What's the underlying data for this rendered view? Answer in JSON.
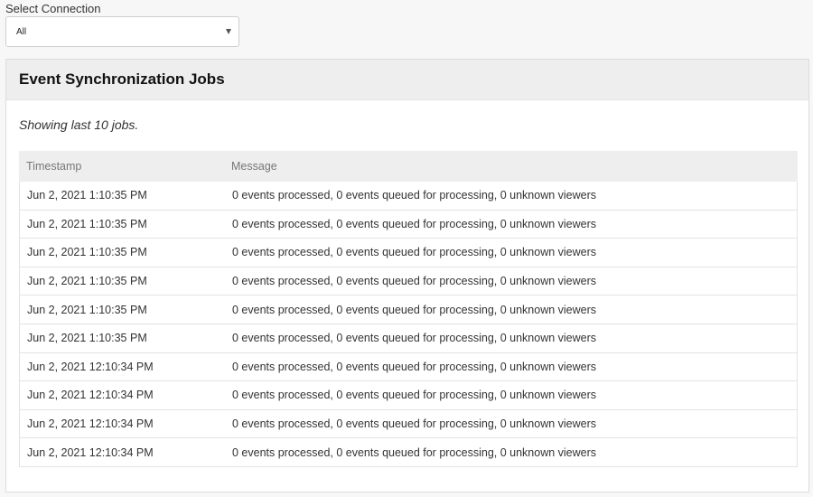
{
  "connection": {
    "label": "Select Connection",
    "selected": "All"
  },
  "panel": {
    "title": "Event Synchronization Jobs",
    "subtitle": "Showing last 10 jobs."
  },
  "table": {
    "headers": {
      "timestamp": "Timestamp",
      "message": "Message"
    },
    "rows": [
      {
        "timestamp": "Jun 2, 2021 1:10:35 PM",
        "message": "0 events processed, 0 events queued for processing, 0 unknown viewers"
      },
      {
        "timestamp": "Jun 2, 2021 1:10:35 PM",
        "message": "0 events processed, 0 events queued for processing, 0 unknown viewers"
      },
      {
        "timestamp": "Jun 2, 2021 1:10:35 PM",
        "message": "0 events processed, 0 events queued for processing, 0 unknown viewers"
      },
      {
        "timestamp": "Jun 2, 2021 1:10:35 PM",
        "message": "0 events processed, 0 events queued for processing, 0 unknown viewers"
      },
      {
        "timestamp": "Jun 2, 2021 1:10:35 PM",
        "message": "0 events processed, 0 events queued for processing, 0 unknown viewers"
      },
      {
        "timestamp": "Jun 2, 2021 1:10:35 PM",
        "message": "0 events processed, 0 events queued for processing, 0 unknown viewers"
      },
      {
        "timestamp": "Jun 2, 2021 12:10:34 PM",
        "message": "0 events processed, 0 events queued for processing, 0 unknown viewers"
      },
      {
        "timestamp": "Jun 2, 2021 12:10:34 PM",
        "message": "0 events processed, 0 events queued for processing, 0 unknown viewers"
      },
      {
        "timestamp": "Jun 2, 2021 12:10:34 PM",
        "message": "0 events processed, 0 events queued for processing, 0 unknown viewers"
      },
      {
        "timestamp": "Jun 2, 2021 12:10:34 PM",
        "message": "0 events processed, 0 events queued for processing, 0 unknown viewers"
      }
    ]
  },
  "icons": {
    "select_chevron": "chevron-down-icon"
  },
  "colors": {
    "page_bg": "#f7f7f7",
    "panel_header_bg": "#eeeeee",
    "table_header_bg": "#eeeeee",
    "border": "#dddddd"
  }
}
